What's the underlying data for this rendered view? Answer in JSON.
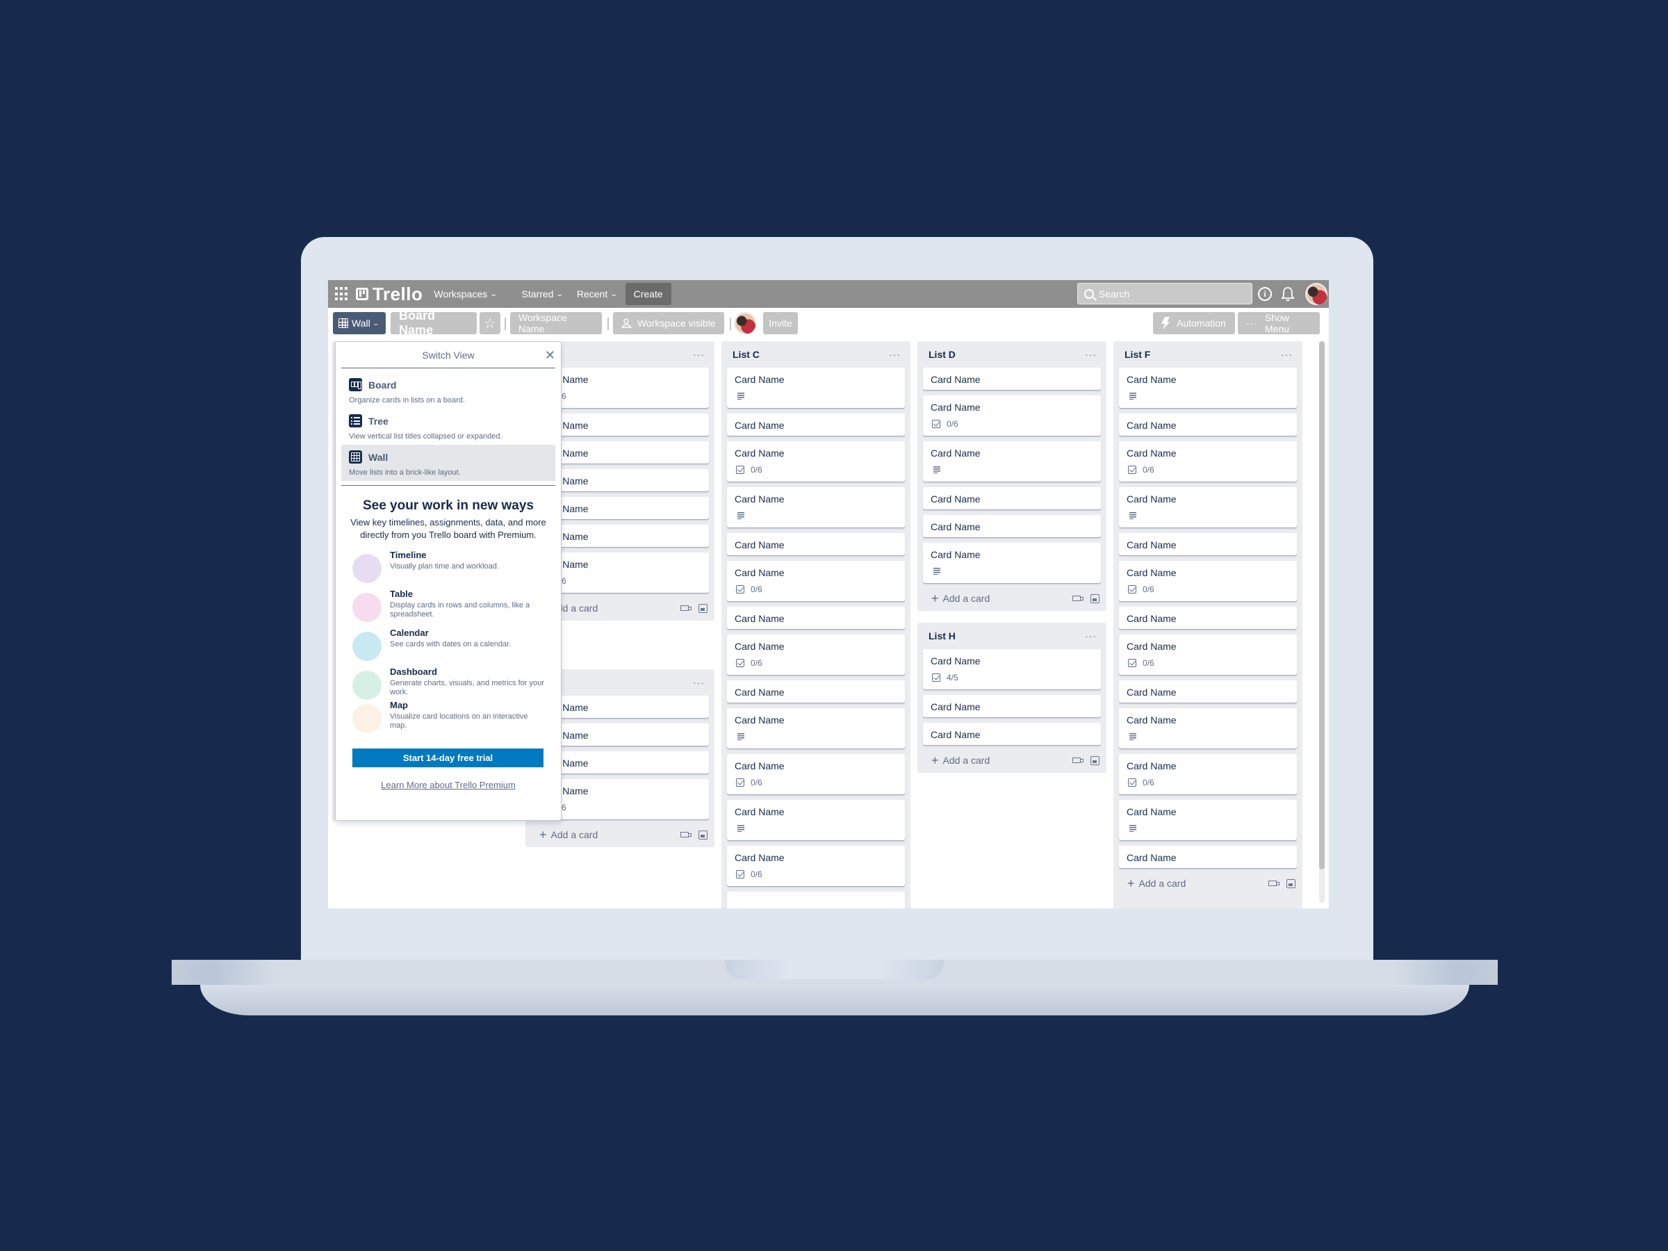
{
  "colors": {
    "background": "#172a4d",
    "laptop": "#dfe6ef",
    "topnav": "#8f8f8f",
    "wall_button": "#4a5b76",
    "trial_button": "#0079bf",
    "list_bg": "#ebecf0"
  },
  "topnav": {
    "apps_icon": "apps-grid-icon",
    "logo_text": "Trello",
    "workspaces": "Workspaces",
    "starred": "Starred",
    "recent": "Recent",
    "create": "Create",
    "search_placeholder": "Search",
    "info_icon": "info-icon",
    "bell_icon": "bell-icon"
  },
  "boardbar": {
    "view_label": "Wall",
    "board_name": "Board Name",
    "star_icon": "star-icon",
    "workspace_name": "Workspace Name",
    "visibility": "Workspace visible",
    "invite": "Invite",
    "automation": "Automation",
    "show_menu": "Show Menu"
  },
  "popup": {
    "title": "Switch View",
    "views": [
      {
        "name": "Board",
        "desc": "Organize cards in lists on a board.",
        "icon": "board-view-icon",
        "selected": false
      },
      {
        "name": "Tree",
        "desc": "View vertical list titles collapsed or expanded.",
        "icon": "tree-view-icon",
        "selected": false
      },
      {
        "name": "Wall",
        "desc": "Move lists into a brick-like layout.",
        "icon": "wall-view-icon",
        "selected": true
      }
    ],
    "promo_title": "See your work in new ways",
    "promo_text": "View key timelines, assignments, data, and more directly from you Trello board with Premium.",
    "features": [
      {
        "name": "Timeline",
        "desc": "Visually plan time and workload.",
        "color": "#e8dcf2"
      },
      {
        "name": "Table",
        "desc": "Display cards in rows and columns, like a spreadsheet.",
        "color": "#f6dcee"
      },
      {
        "name": "Calendar",
        "desc": "See cards with dates on a calendar.",
        "color": "#c7e9f2"
      },
      {
        "name": "Dashboard",
        "desc": "Generate charts, visuals, and metrics for your work.",
        "color": "#d6f1e3"
      },
      {
        "name": "Map",
        "desc": "Visualize card locations on an interactive map.",
        "color": "#fdf1e5"
      }
    ],
    "trial_button": "Start 14-day free trial",
    "learn_more": "Learn More about Trello Premium"
  },
  "lists": {
    "list_b": {
      "title": "",
      "cards": [
        {
          "title": "Card Name",
          "badge": "checklist",
          "badge_text": "0/6"
        },
        {
          "title": "Card Name",
          "badge": "none",
          "badge_text": ""
        },
        {
          "title": "Card Name",
          "badge": "none",
          "badge_text": ""
        },
        {
          "title": "Card Name",
          "badge": "none",
          "badge_text": ""
        },
        {
          "title": "Card Name",
          "badge": "none",
          "badge_text": ""
        },
        {
          "title": "Card Name",
          "badge": "none",
          "badge_text": ""
        },
        {
          "title": "Card Name",
          "badge": "checklist",
          "badge_text": "0/6"
        }
      ],
      "add_card": "Add a card"
    },
    "list_e": {
      "title": "",
      "cards": [
        {
          "title": "Card Name",
          "badge": "none",
          "badge_text": ""
        },
        {
          "title": "Card Name",
          "badge": "none",
          "badge_text": ""
        },
        {
          "title": "Card Name",
          "badge": "none",
          "badge_text": ""
        },
        {
          "title": "Card Name",
          "badge": "checklist",
          "badge_text": "0/6"
        }
      ],
      "add_card": "Add a card"
    },
    "list_c": {
      "title": "List C",
      "cards": [
        {
          "title": "Card Name",
          "badge": "description",
          "badge_text": ""
        },
        {
          "title": "Card Name",
          "badge": "none",
          "badge_text": ""
        },
        {
          "title": "Card Name",
          "badge": "checklist",
          "badge_text": "0/6"
        },
        {
          "title": "Card Name",
          "badge": "description",
          "badge_text": ""
        },
        {
          "title": "Card Name",
          "badge": "none",
          "badge_text": ""
        },
        {
          "title": "Card Name",
          "badge": "checklist",
          "badge_text": "0/6"
        },
        {
          "title": "Card Name",
          "badge": "none",
          "badge_text": ""
        },
        {
          "title": "Card Name",
          "badge": "checklist",
          "badge_text": "0/6"
        },
        {
          "title": "Card Name",
          "badge": "none",
          "badge_text": ""
        },
        {
          "title": "Card Name",
          "badge": "description",
          "badge_text": ""
        },
        {
          "title": "Card Name",
          "badge": "checklist",
          "badge_text": "0/6"
        },
        {
          "title": "Card Name",
          "badge": "description",
          "badge_text": ""
        },
        {
          "title": "Card Name",
          "badge": "checklist",
          "badge_text": "0/6"
        },
        {
          "title": "",
          "badge": "none",
          "badge_text": ""
        }
      ]
    },
    "list_d": {
      "title": "List D",
      "cards": [
        {
          "title": "Card Name",
          "badge": "none",
          "badge_text": ""
        },
        {
          "title": "Card Name",
          "badge": "checklist",
          "badge_text": "0/6"
        },
        {
          "title": "Card Name",
          "badge": "description",
          "badge_text": ""
        },
        {
          "title": "Card Name",
          "badge": "none",
          "badge_text": ""
        },
        {
          "title": "Card Name",
          "badge": "none",
          "badge_text": ""
        },
        {
          "title": "Card Name",
          "badge": "description",
          "badge_text": ""
        }
      ],
      "add_card": "Add a card"
    },
    "list_h": {
      "title": "List H",
      "cards": [
        {
          "title": "Card Name",
          "badge": "checklist",
          "badge_text": "4/5"
        },
        {
          "title": "Card Name",
          "badge": "none",
          "badge_text": ""
        },
        {
          "title": "Card Name",
          "badge": "none",
          "badge_text": ""
        }
      ],
      "add_card": "Add a card"
    },
    "list_f": {
      "title": "List F",
      "cards": [
        {
          "title": "Card Name",
          "badge": "description",
          "badge_text": ""
        },
        {
          "title": "Card Name",
          "badge": "none",
          "badge_text": ""
        },
        {
          "title": "Card Name",
          "badge": "checklist",
          "badge_text": "0/6"
        },
        {
          "title": "Card Name",
          "badge": "description",
          "badge_text": ""
        },
        {
          "title": "Card Name",
          "badge": "none",
          "badge_text": ""
        },
        {
          "title": "Card Name",
          "badge": "checklist",
          "badge_text": "0/6"
        },
        {
          "title": "Card Name",
          "badge": "none",
          "badge_text": ""
        },
        {
          "title": "Card Name",
          "badge": "checklist",
          "badge_text": "0/6"
        },
        {
          "title": "Card Name",
          "badge": "none",
          "badge_text": ""
        },
        {
          "title": "Card Name",
          "badge": "description",
          "badge_text": ""
        },
        {
          "title": "Card Name",
          "badge": "checklist",
          "badge_text": "0/6"
        },
        {
          "title": "Card Name",
          "badge": "description",
          "badge_text": ""
        },
        {
          "title": "Card Name",
          "badge": "none",
          "badge_text": ""
        }
      ],
      "add_card": "Add a card"
    }
  }
}
